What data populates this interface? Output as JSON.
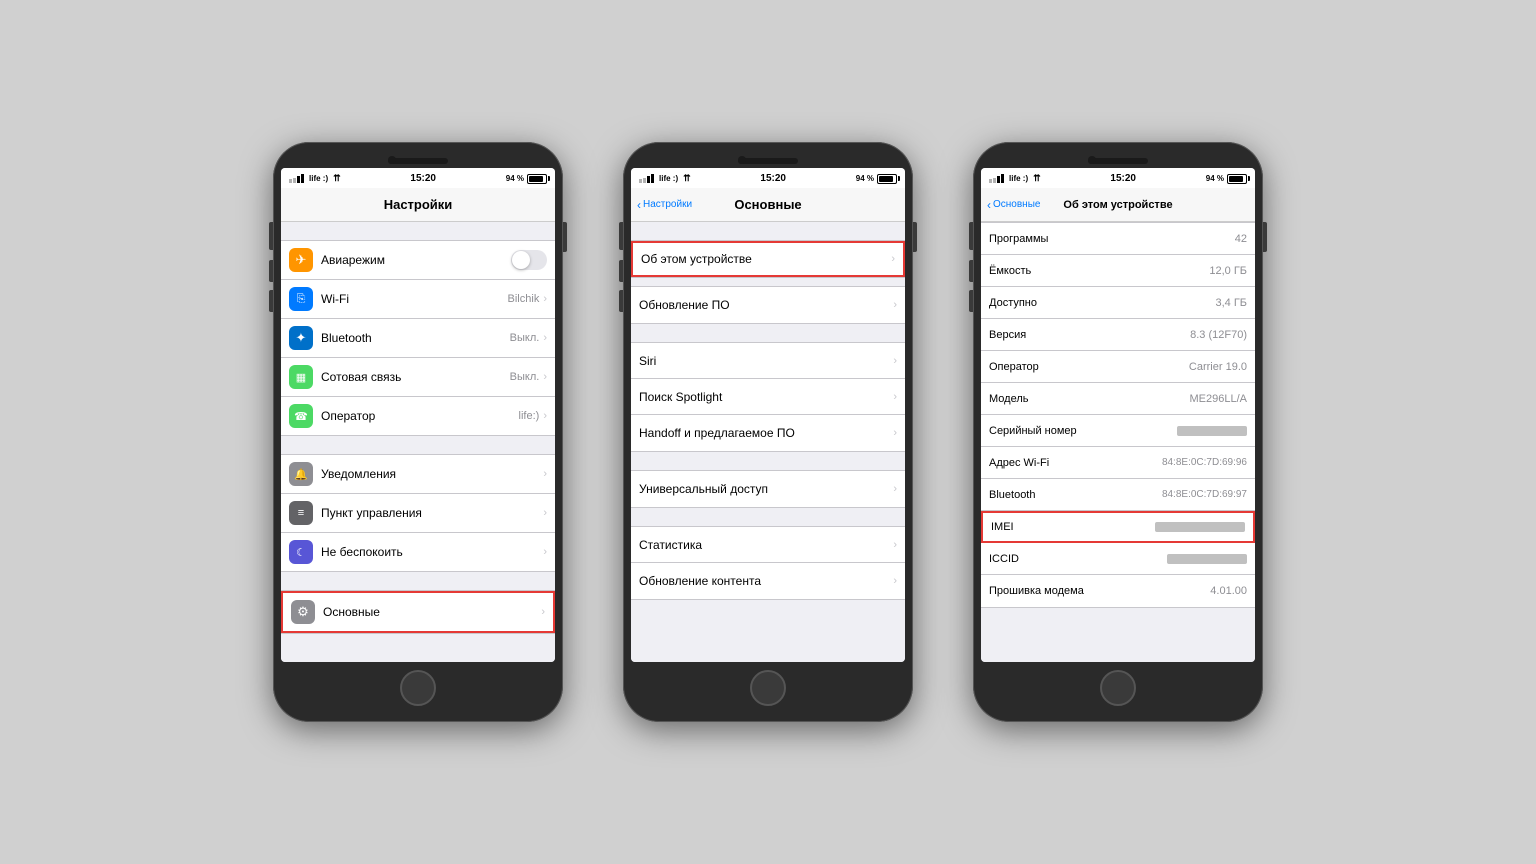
{
  "background": "#d0d0d0",
  "phones": [
    {
      "id": "phone1",
      "status_bar": {
        "signal_dots": "●●●○○",
        "carrier": "life :)",
        "wifi": "▾",
        "time": "15:20",
        "battery_pct": "94 %"
      },
      "nav": {
        "title": "Настройки",
        "back": null
      },
      "sections": [
        {
          "items": [
            {
              "icon": "orange",
              "icon_char": "✈",
              "label": "Авиарежим",
              "value": "",
              "type": "toggle",
              "toggle_on": false
            },
            {
              "icon": "blue",
              "icon_char": "📶",
              "label": "Wi-Fi",
              "value": "Bilchik",
              "type": "chevron"
            },
            {
              "icon": "blue-dark",
              "icon_char": "✦",
              "label": "Bluetooth",
              "value": "Выкл.",
              "type": "chevron"
            },
            {
              "icon": "green",
              "icon_char": "▦",
              "label": "Сотовая связь",
              "value": "Выкл.",
              "type": "chevron"
            },
            {
              "icon": "green",
              "icon_char": "☎",
              "label": "Оператор",
              "value": "life:)",
              "type": "chevron"
            }
          ]
        },
        {
          "items": [
            {
              "icon": "gray",
              "icon_char": "🔔",
              "label": "Уведомления",
              "value": "",
              "type": "chevron"
            },
            {
              "icon": "gray2",
              "icon_char": "≡",
              "label": "Пункт управления",
              "value": "",
              "type": "chevron"
            },
            {
              "icon": "purple",
              "icon_char": "☾",
              "label": "Не беспокоить",
              "value": "",
              "type": "chevron"
            }
          ]
        },
        {
          "items": [
            {
              "icon": "gray",
              "icon_char": "⚙",
              "label": "Основные",
              "value": "",
              "type": "chevron",
              "highlighted": true
            }
          ]
        }
      ]
    },
    {
      "id": "phone2",
      "status_bar": {
        "carrier": "life :)",
        "time": "15:20",
        "battery_pct": "94 %"
      },
      "nav": {
        "title": "Основные",
        "back": "Настройки"
      },
      "sections": [
        {
          "items": [
            {
              "icon": null,
              "label": "Об этом устройстве",
              "value": "",
              "type": "chevron",
              "highlighted": true
            }
          ]
        },
        {
          "items": [
            {
              "icon": null,
              "label": "Обновление ПО",
              "value": "",
              "type": "chevron"
            }
          ]
        },
        {
          "items": [
            {
              "icon": null,
              "label": "Siri",
              "value": "",
              "type": "chevron"
            },
            {
              "icon": null,
              "label": "Поиск Spotlight",
              "value": "",
              "type": "chevron"
            },
            {
              "icon": null,
              "label": "Handoff и предлагаемое ПО",
              "value": "",
              "type": "chevron"
            }
          ]
        },
        {
          "items": [
            {
              "icon": null,
              "label": "Универсальный доступ",
              "value": "",
              "type": "chevron"
            }
          ]
        },
        {
          "items": [
            {
              "icon": null,
              "label": "Статистика",
              "value": "",
              "type": "chevron"
            },
            {
              "icon": null,
              "label": "Обновление контента",
              "value": "",
              "type": "chevron"
            }
          ]
        }
      ]
    },
    {
      "id": "phone3",
      "status_bar": {
        "carrier": "life :)",
        "time": "15:20",
        "battery_pct": "94 %"
      },
      "nav": {
        "title": "Об этом устройстве",
        "back": "Основные"
      },
      "about_rows": [
        {
          "label": "Программы",
          "value": "42",
          "blurred": false
        },
        {
          "label": "Ёмкость",
          "value": "12,0 ГБ",
          "blurred": false
        },
        {
          "label": "Доступно",
          "value": "3,4 ГБ",
          "blurred": false
        },
        {
          "label": "Версия",
          "value": "8.3 (12F70)",
          "blurred": false
        },
        {
          "label": "Оператор",
          "value": "Carrier 19.0",
          "blurred": false
        },
        {
          "label": "Модель",
          "value": "ME296LL/A",
          "blurred": false
        },
        {
          "label": "Серийный номер",
          "value": "blurred",
          "blurred": true
        },
        {
          "label": "Адрес Wi-Fi",
          "value": "84:8E:0C:7D:69:96",
          "blurred": false
        },
        {
          "label": "Bluetooth",
          "value": "84:8E:0C:7D:69:97",
          "blurred": false
        },
        {
          "label": "IMEI",
          "value": "blurred_long",
          "blurred": true,
          "highlighted": true
        },
        {
          "label": "ICCID",
          "value": "blurred_mid",
          "blurred": true
        },
        {
          "label": "Прошивка модема",
          "value": "4.01.00",
          "blurred": false
        }
      ]
    }
  ]
}
